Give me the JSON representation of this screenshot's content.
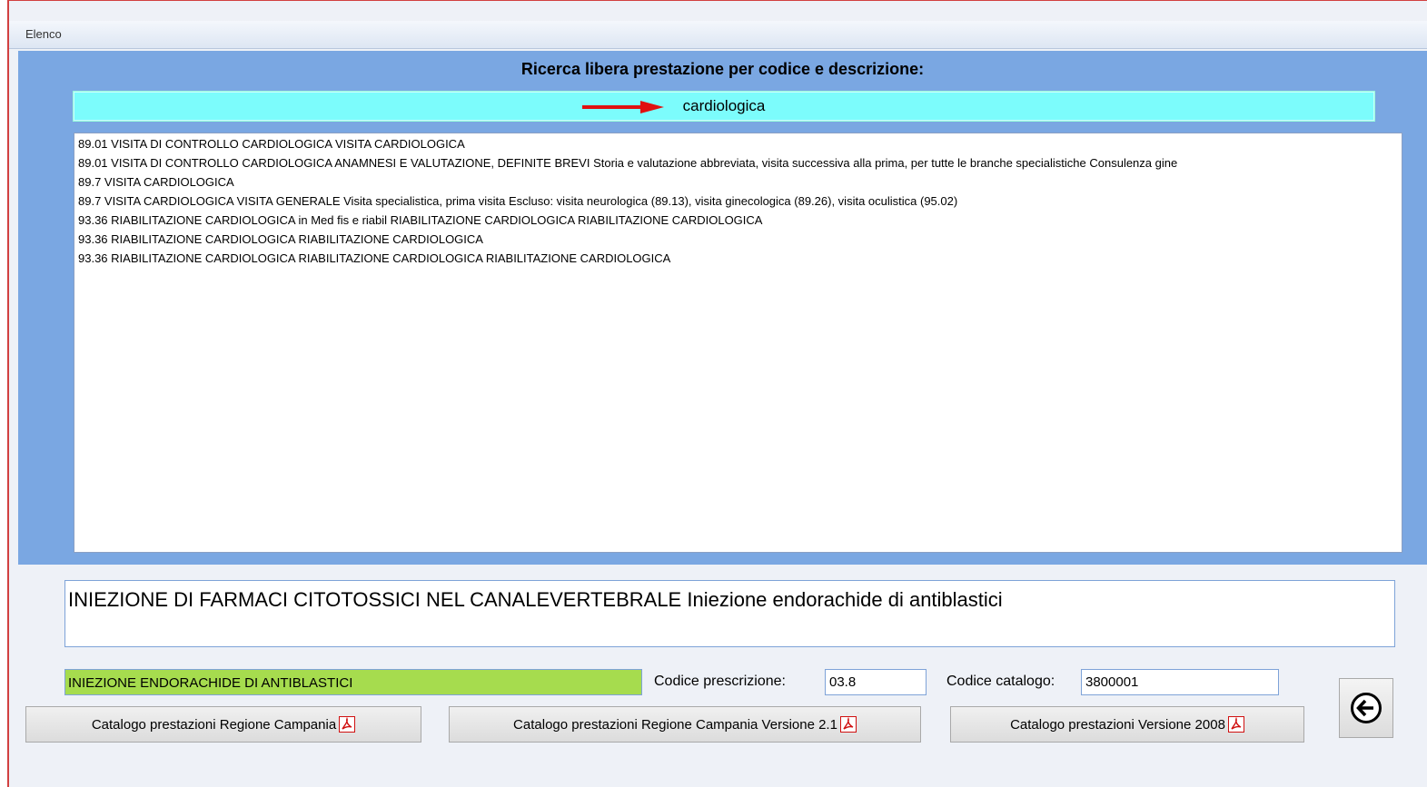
{
  "window": {
    "title": "Elenco"
  },
  "search": {
    "heading": "Ricerca libera prestazione per codice e descrizione:",
    "value": "cardiologica"
  },
  "results": [
    "89.01 VISITA DI CONTROLLO CARDIOLOGICA  VISITA CARDIOLOGICA",
    "89.01 VISITA DI CONTROLLO CARDIOLOGICA ANAMNESI E VALUTAZIONE, DEFINITE BREVI Storia e valutazione abbreviata, visita successiva alla prima, per tutte le branche specialistiche Consulenza gine",
    "89.7 VISITA CARDIOLOGICA",
    "89.7 VISITA CARDIOLOGICA VISITA GENERALE Visita specialistica, prima visita Escluso: visita neurologica (89.13), visita ginecologica (89.26), visita oculistica (95.02)",
    "93.36 RIABILITAZIONE CARDIOLOGICA in Med fis e riabil RIABILITAZIONE CARDIOLOGICA   RIABILITAZIONE CARDIOLOGICA",
    "93.36 RIABILITAZIONE CARDIOLOGICA RIABILITAZIONE CARDIOLOGICA",
    "93.36 RIABILITAZIONE CARDIOLOGICA RIABILITAZIONE CARDIOLOGICA   RIABILITAZIONE CARDIOLOGICA"
  ],
  "detail": {
    "description": "INIEZIONE DI FARMACI CITOTOSSICI NEL CANALEVERTEBRALE Iniezione endorachide di antiblastici",
    "short_name": "INIEZIONE ENDORACHIDE DI ANTIBLASTICI",
    "codice_prescrizione_label": "Codice prescrizione:",
    "codice_prescrizione": "03.8",
    "codice_catalogo_label": "Codice catalogo:",
    "codice_catalogo": "3800001"
  },
  "buttons": {
    "catalogo_campania": "Catalogo prestazioni Regione Campania",
    "catalogo_campania_21": "Catalogo prestazioni Regione Campania Versione 2.1",
    "catalogo_2008": "Catalogo prestazioni  Versione 2008"
  },
  "icons": {
    "pdf": "pdf-icon",
    "back": "back-arrow-icon",
    "pointer": "red-arrow-icon"
  },
  "colors": {
    "panel_blue": "#7aa7e2",
    "search_cyan": "#7cfcfc",
    "green_field": "#a6dc4e",
    "arrow_red": "#e01010"
  }
}
